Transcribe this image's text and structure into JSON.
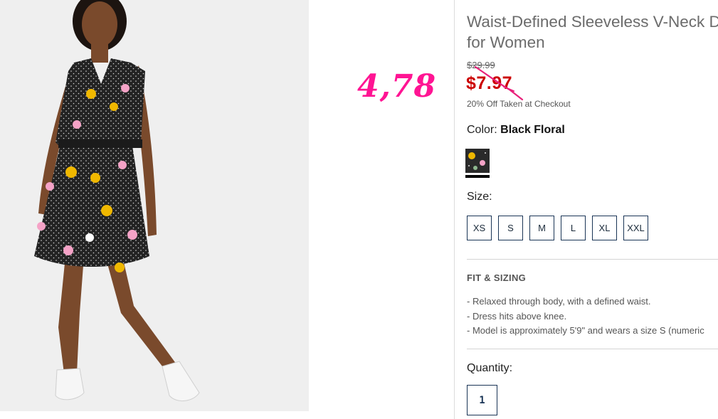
{
  "annotation": {
    "text": "4,78",
    "color": "#ff1493"
  },
  "product": {
    "title_line1": "Waist-Defined Sleeveless V-Neck D",
    "title_line2": "for Women",
    "original_price": "$29.99",
    "sale_price": "$7.97",
    "checkout_note": "20% Off Taken at Checkout",
    "color_label": "Color:",
    "color_value": "Black Floral",
    "size_label": "Size:",
    "sizes": [
      "XS",
      "S",
      "M",
      "L",
      "XL",
      "XXL"
    ],
    "fit_heading": "FIT & SIZING",
    "fit_points": [
      "Relaxed through body, with a defined waist.",
      "Dress hits above knee.",
      "Model is approximately 5'9\" and wears a size S (numeric"
    ],
    "quantity_label": "Quantity:",
    "quantity_value": "1"
  },
  "colors": {
    "sale": "#cc0000",
    "border": "#1a3556"
  }
}
